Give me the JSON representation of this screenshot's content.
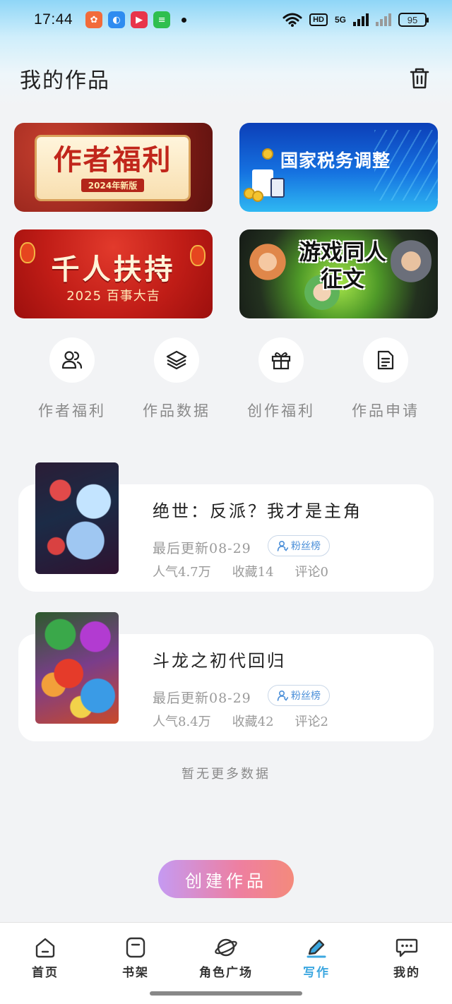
{
  "status_bar": {
    "time": "17:44",
    "hd_label": "HD",
    "network_label": "5G",
    "battery": "95"
  },
  "header": {
    "title": "我的作品"
  },
  "banners": [
    {
      "title": "作者福利",
      "tag": "2024年新版",
      "icon": "author-welfare-banner"
    },
    {
      "title": "国家税务调整",
      "icon": "tax-banner"
    },
    {
      "title": "千人扶持",
      "subtitle": "2025 百事大吉",
      "icon": "support-banner"
    },
    {
      "title": "游戏同人征文",
      "icon": "game-fanfic-banner"
    }
  ],
  "actions": [
    {
      "label": "作者福利",
      "icon": "users-icon"
    },
    {
      "label": "作品数据",
      "icon": "layers-icon"
    },
    {
      "label": "创作福利",
      "icon": "gift-icon"
    },
    {
      "label": "作品申请",
      "icon": "document-icon"
    }
  ],
  "works": [
    {
      "title": "绝世：反派？我才是主角",
      "updated": "最后更新08-29",
      "fans_label": "粉丝榜",
      "popularity": "人气4.7万",
      "favorites": "收藏14",
      "comments": "评论0"
    },
    {
      "title": "斗龙之初代回归",
      "updated": "最后更新08-29",
      "fans_label": "粉丝榜",
      "popularity": "人气8.4万",
      "favorites": "收藏42",
      "comments": "评论2"
    }
  ],
  "no_more": "暂无更多数据",
  "create_button": "创建作品",
  "nav": [
    {
      "label": "首页",
      "icon": "home-icon"
    },
    {
      "label": "书架",
      "icon": "bookshelf-icon"
    },
    {
      "label": "角色广场",
      "icon": "planet-icon"
    },
    {
      "label": "写作",
      "icon": "pen-icon",
      "active": true
    },
    {
      "label": "我的",
      "icon": "chat-icon"
    }
  ],
  "colors": {
    "accent": "#3ca7e0",
    "create_gradient_start": "#c59af2",
    "create_gradient_end": "#f48a7c",
    "background": "#f2f3f5"
  }
}
